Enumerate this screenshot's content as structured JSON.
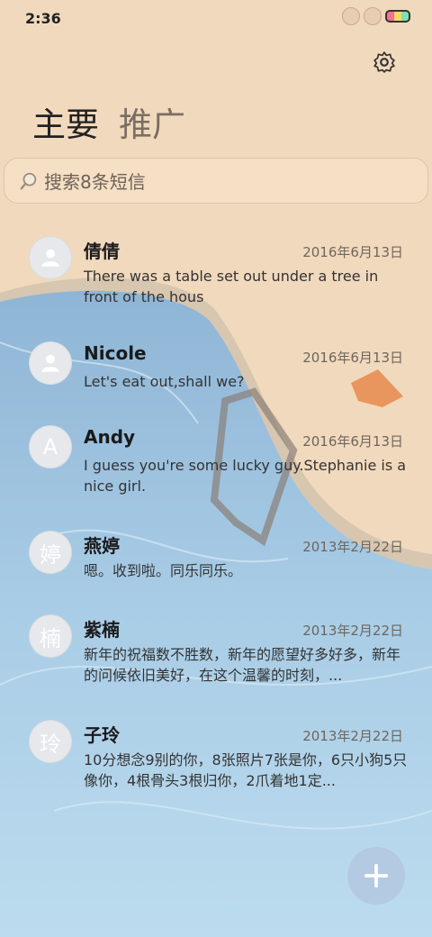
{
  "status_bar": {
    "time": "2:36"
  },
  "tabs": [
    {
      "label": "主要",
      "active": true
    },
    {
      "label": "推广",
      "active": false
    }
  ],
  "search": {
    "placeholder": "搜索8条短信"
  },
  "messages": [
    {
      "avatar_type": "person-icon",
      "avatar_letter": "",
      "name": "倩倩",
      "date": "2016年6月13日",
      "preview": "There was a table set out under a tree in front of the hous"
    },
    {
      "avatar_type": "person-icon",
      "avatar_letter": "",
      "name": "Nicole",
      "date": "2016年6月13日",
      "preview": "Let's eat out,shall we?"
    },
    {
      "avatar_type": "letter",
      "avatar_letter": "A",
      "name": "Andy",
      "date": "2016年6月13日",
      "preview": "I guess you're some lucky guy.Stephanie is a nice girl."
    },
    {
      "avatar_type": "letter",
      "avatar_letter": "婷",
      "name": "燕婷",
      "date": "2013年2月22日",
      "preview": "嗯。收到啦。同乐同乐。"
    },
    {
      "avatar_type": "letter",
      "avatar_letter": "楠",
      "name": "紫楠",
      "date": "2013年2月22日",
      "preview": "新年的祝福数不胜数，新年的愿望好多好多，新年的问候依旧美好，在这个温馨的时刻，..."
    },
    {
      "avatar_type": "letter",
      "avatar_letter": "玲",
      "name": "子玲",
      "date": "2013年2月22日",
      "preview": "10分想念9别的你，8张照片7张是你，6只小狗5只像你，4根骨头3根归你，2爪着地1定..."
    }
  ],
  "colors": {
    "sand": "#f1d9bd",
    "water": "#a9cbe3",
    "fab": "#b4c8e1"
  }
}
